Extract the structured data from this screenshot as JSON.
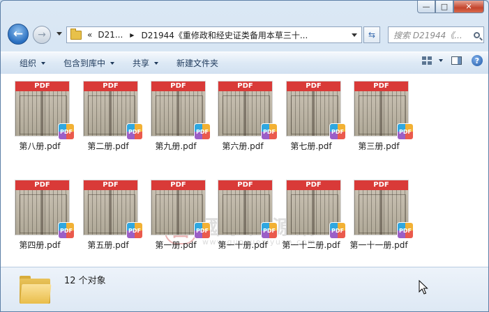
{
  "window": {
    "caption_buttons": [
      {
        "name": "minimize-button",
        "glyph": "—"
      },
      {
        "name": "maximize-button",
        "glyph": "□"
      },
      {
        "name": "close-button",
        "glyph": "✕"
      }
    ]
  },
  "navigation": {
    "back_glyph": "←",
    "forward_glyph": "→",
    "breadcrumb_overflow": "«",
    "breadcrumb": [
      "D21...",
      "D21944《重修政和经史证类备用本草三十..."
    ],
    "breadcrumb_sep": "▶",
    "refresh_glyph": "⇆",
    "search_placeholder": "搜索 D21944《..."
  },
  "toolbar": {
    "organize": "组织",
    "include_in_library": "包含到库中",
    "share": "共享",
    "new_folder": "新建文件夹",
    "help_glyph": "?"
  },
  "files": [
    {
      "name": "第八册.pdf",
      "band": "PDF",
      "badge": "PDF"
    },
    {
      "name": "第二册.pdf",
      "band": "PDF",
      "badge": "PDF"
    },
    {
      "name": "第九册.pdf",
      "band": "PDF",
      "badge": "PDF"
    },
    {
      "name": "第六册.pdf",
      "band": "PDF",
      "badge": "PDF"
    },
    {
      "name": "第七册.pdf",
      "band": "PDF",
      "badge": "PDF"
    },
    {
      "name": "第三册.pdf",
      "band": "PDF",
      "badge": "PDF"
    },
    {
      "name": "第四册.pdf",
      "band": "PDF",
      "badge": "PDF"
    },
    {
      "name": "第五册.pdf",
      "band": "PDF",
      "badge": "PDF"
    },
    {
      "name": "第一册.pdf",
      "band": "PDF",
      "badge": "PDF"
    },
    {
      "name": "第一十册.pdf",
      "band": "PDF",
      "badge": "PDF"
    },
    {
      "name": "第一十二册.pdf",
      "band": "PDF",
      "badge": "PDF"
    },
    {
      "name": "第一十一册.pdf",
      "band": "PDF",
      "badge": "PDF"
    }
  ],
  "watermark": {
    "seal": "国",
    "title": "國學資源網",
    "url": "www.guoxueziyuan.com"
  },
  "details": {
    "count_text": "12 个对象"
  }
}
